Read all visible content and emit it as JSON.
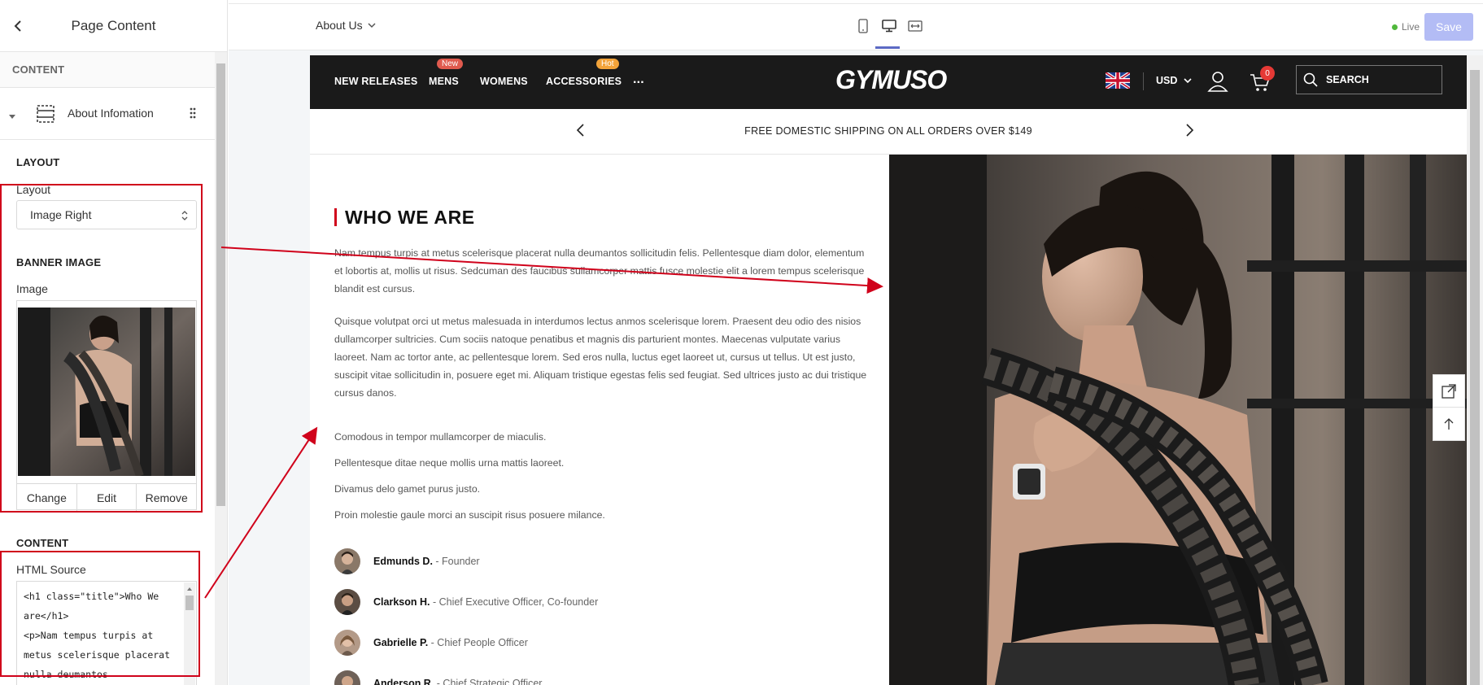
{
  "sidebar": {
    "title": "Page Content",
    "content_caption": "CONTENT",
    "block": {
      "label": "About Infomation"
    },
    "layout_caption": "LAYOUT",
    "layout_label": "Layout",
    "layout_value": "Image Right",
    "banner_caption": "BANNER IMAGE",
    "image_label": "Image",
    "image_buttons": {
      "change": "Change",
      "edit": "Edit",
      "remove": "Remove"
    },
    "content2_caption": "CONTENT",
    "html_label": "HTML Source",
    "html_lines": [
      "<h1 class=\"title\">Who We",
      "are</h1>",
      "<p>Nam tempus turpis at",
      "metus scelerisque placerat",
      "nulla deumantos"
    ]
  },
  "topbar": {
    "page_selector": "About Us",
    "live_label": "Live",
    "save_label": "Save"
  },
  "site": {
    "nav": [
      {
        "label": "NEW RELEASES"
      },
      {
        "label": "MENS",
        "badge": "New",
        "badge_color": "#e05a4e"
      },
      {
        "label": "WOMENS"
      },
      {
        "label": "ACCESSORIES",
        "badge": "Hot",
        "badge_color": "#f2a33a"
      },
      {
        "label": "..."
      }
    ],
    "logo": "GYMUSO",
    "currency": "USD",
    "cart_count": "0",
    "search_label": "SEARCH",
    "announcement": "FREE DOMESTIC SHIPPING ON ALL ORDERS OVER $149",
    "heading": "WHO WE ARE",
    "paragraph1": "Nam tempus turpis at metus scelerisque placerat nulla deumantos sollicitudin felis. Pellentesque diam dolor, elementum et lobortis at, mollis ut risus. Sedcuman des faucibus sullamcorper mattis fusce molestie elit a lorem tempus scelerisque blandit est cursus.",
    "paragraph2": "Quisque volutpat orci ut metus malesuada in interdumos lectus anmos scelerisque lorem. Praesent deu odio des nisios dullamcorper sultricies. Cum sociis natoque penatibus et magnis dis parturient montes. Maecenas vulputate varius laoreet. Nam ac tortor ante, ac pellentesque lorem. Sed eros nulla, luctus eget laoreet ut, cursus ut tellus. Ut est justo, suscipit vitae sollicitudin in, posuere eget mi. Aliquam tristique egestas felis sed feugiat. Sed ultrices justo ac dui tristique cursus danos.",
    "lines": [
      "Comodous in tempor mullamcorper de miaculis.",
      "Pellentesque ditae neque mollis urna mattis laoreet.",
      "Divamus delo gamet purus justo.",
      "Proin molestie gaule morci an suscipit risus posuere milance."
    ],
    "team": [
      {
        "name": "Edmunds D.",
        "role": "- Founder"
      },
      {
        "name": "Clarkson H.",
        "role": "- Chief Executive Officer, Co-founder"
      },
      {
        "name": "Gabrielle P.",
        "role": "- Chief People Officer"
      },
      {
        "name": "Anderson R.",
        "role": "- Chief Strategic Officer"
      }
    ]
  },
  "colors": {
    "accent_red": "#d0021b",
    "nav_bg": "#1a1a1a",
    "save_disabled": "#b3bcf5",
    "live_green": "#50b83c"
  }
}
